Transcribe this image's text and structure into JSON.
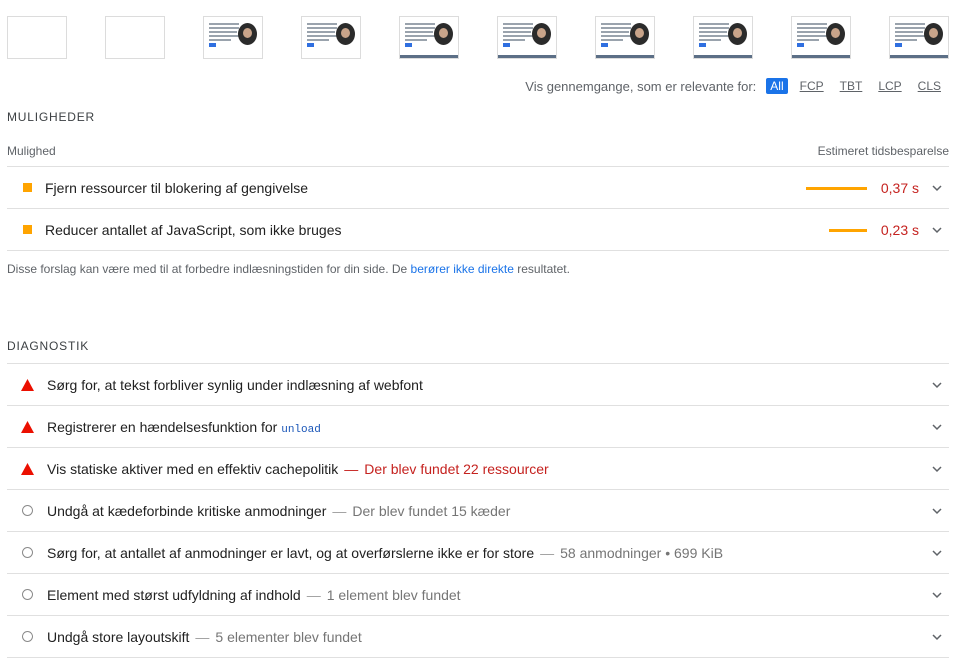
{
  "filmstrip": {
    "frames": [
      {
        "state": "blank"
      },
      {
        "state": "blank"
      },
      {
        "state": "page"
      },
      {
        "state": "page"
      },
      {
        "state": "page"
      },
      {
        "state": "page"
      },
      {
        "state": "page"
      },
      {
        "state": "page"
      },
      {
        "state": "page"
      },
      {
        "state": "page"
      }
    ]
  },
  "filter": {
    "label": "Vis gennemgange, som er relevante for:",
    "chips": [
      "All",
      "FCP",
      "TBT",
      "LCP",
      "CLS"
    ],
    "active": "All"
  },
  "opportunities": {
    "heading": "MULIGHEDER",
    "col_left": "Mulighed",
    "col_right": "Estimeret tidsbesparelse",
    "items": [
      {
        "title": "Fjern ressourcer til blokering af gengivelse",
        "savings": "0,37 s",
        "savings_value": 0.37
      },
      {
        "title": "Reducer antallet af JavaScript, som ikke bruges",
        "savings": "0,23 s",
        "savings_value": 0.23
      }
    ],
    "note_before": "Disse forslag kan være med til at forbedre indlæsningstiden for din side. De ",
    "note_link": "berører ikke direkte",
    "note_after": " resultatet."
  },
  "diagnostics": {
    "heading": "DIAGNOSTIK",
    "items": [
      {
        "status": "fail",
        "title": "Sørg for, at tekst forbliver synlig under indlæsning af webfont",
        "detail": ""
      },
      {
        "status": "fail",
        "title": "Registrerer en hændelsesfunktion for ",
        "code": "unload",
        "detail": ""
      },
      {
        "status": "fail",
        "title": "Vis statiske aktiver med en effektiv cachepolitik",
        "detail": "Der blev fundet 22 ressourcer"
      },
      {
        "status": "info",
        "title": "Undgå at kædeforbinde kritiske anmodninger",
        "detail": "Der blev fundet 15 kæder"
      },
      {
        "status": "info",
        "title": "Sørg for, at antallet af anmodninger er lavt, og at overførslerne ikke er for store",
        "detail": "58 anmodninger • 699 KiB"
      },
      {
        "status": "info",
        "title": "Element med størst udfyldning af indhold",
        "detail": "1 element blev fundet"
      },
      {
        "status": "info",
        "title": "Undgå store layoutskift",
        "detail": "5 elementer blev fundet"
      }
    ]
  },
  "colors": {
    "accent": "#1a73e8",
    "average": "#ffa400",
    "fail": "#eb0f00",
    "fail_text": "#c5221f"
  },
  "icons": {
    "opportunity": "orange-square-icon",
    "fail": "red-triangle-icon",
    "info": "gray-circle-icon",
    "expand": "chevron-down-icon"
  }
}
